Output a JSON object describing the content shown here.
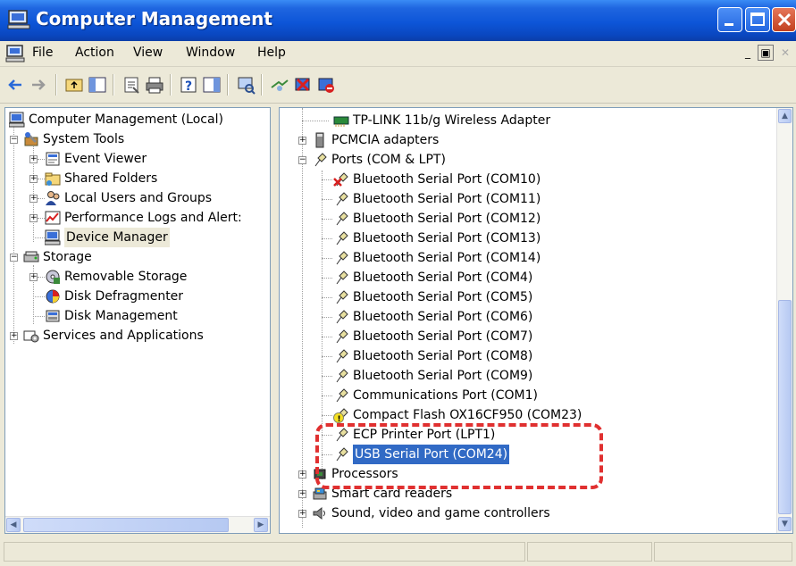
{
  "window": {
    "title": "Computer Management"
  },
  "menu": {
    "items": [
      "File",
      "Action",
      "View",
      "Window",
      "Help"
    ]
  },
  "left_tree": [
    {
      "label": "Computer Management (Local)"
    },
    {
      "label": "System Tools"
    },
    {
      "label": "Event Viewer"
    },
    {
      "label": "Shared Folders"
    },
    {
      "label": "Local Users and Groups"
    },
    {
      "label": "Performance Logs and Alert:"
    },
    {
      "label": "Device Manager"
    },
    {
      "label": "Storage"
    },
    {
      "label": "Removable Storage"
    },
    {
      "label": "Disk Defragmenter"
    },
    {
      "label": "Disk Management"
    },
    {
      "label": "Services and Applications"
    }
  ],
  "right_tree": [
    {
      "label": "TP-LINK 11b/g Wireless Adapter"
    },
    {
      "label": "PCMCIA adapters"
    },
    {
      "label": "Ports (COM & LPT)"
    },
    {
      "label": "Bluetooth Serial Port (COM10)"
    },
    {
      "label": "Bluetooth Serial Port (COM11)"
    },
    {
      "label": "Bluetooth Serial Port (COM12)"
    },
    {
      "label": "Bluetooth Serial Port (COM13)"
    },
    {
      "label": "Bluetooth Serial Port (COM14)"
    },
    {
      "label": "Bluetooth Serial Port (COM4)"
    },
    {
      "label": "Bluetooth Serial Port (COM5)"
    },
    {
      "label": "Bluetooth Serial Port (COM6)"
    },
    {
      "label": "Bluetooth Serial Port (COM7)"
    },
    {
      "label": "Bluetooth Serial Port (COM8)"
    },
    {
      "label": "Bluetooth Serial Port (COM9)"
    },
    {
      "label": "Communications Port (COM1)"
    },
    {
      "label": "Compact Flash OX16CF950 (COM23)"
    },
    {
      "label": "ECP Printer Port (LPT1)"
    },
    {
      "label": "USB Serial Port (COM24)"
    },
    {
      "label": "Processors"
    },
    {
      "label": "Smart card readers"
    },
    {
      "label": "Sound, video and game controllers"
    }
  ],
  "colors": {
    "titlebar": "#0a47c0",
    "selection": "#316ac5",
    "annotation": "#e03030"
  }
}
